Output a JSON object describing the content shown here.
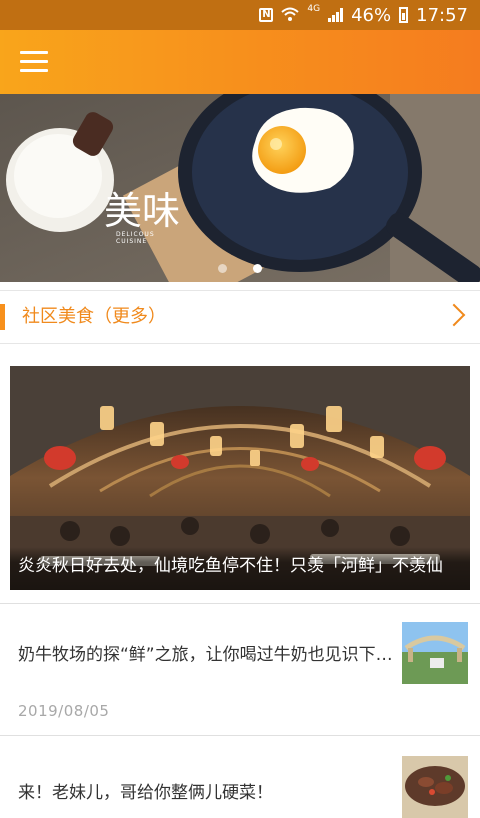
{
  "status": {
    "network": "4G",
    "battery_percent": "46%",
    "time": "17:57"
  },
  "header": {
    "menu_icon": "hamburger-menu-icon",
    "accent": "#f7901c"
  },
  "banner": {
    "logo_text": "美味",
    "logo_subtext_line1": "DELICOUS",
    "logo_subtext_line2": "CUISINE",
    "slide_count": 2,
    "active_slide": 2
  },
  "section": {
    "title": "社区美食（更多）"
  },
  "featured": {
    "caption": "炎炎秋日好去处，仙境吃鱼停不住！只羡「河鲜」不羡仙"
  },
  "articles": [
    {
      "title": "奶牛牧场的探“鲜”之旅，让你喝过牛奶也见识下鲜奶的美味",
      "date": "2019/08/05"
    },
    {
      "title": "来！老妹儿，哥给你整俩儿硬菜！",
      "date": ""
    }
  ]
}
